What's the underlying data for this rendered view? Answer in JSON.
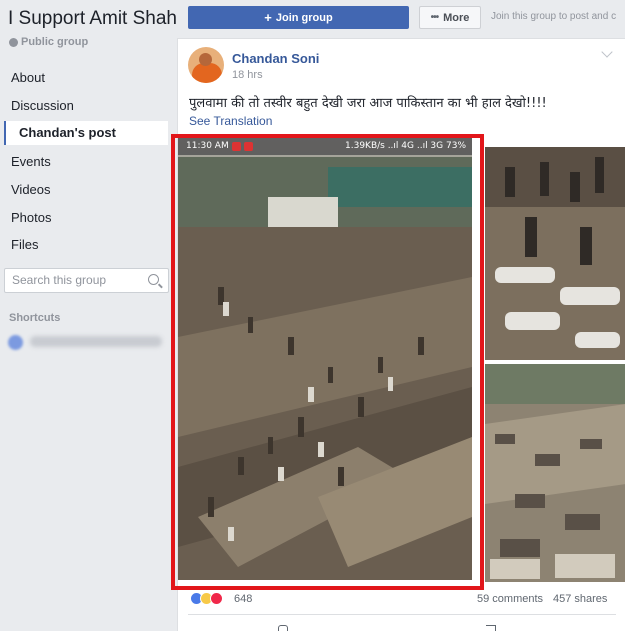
{
  "sidebar": {
    "group_title": "I Support Amit Shah",
    "privacy": "Public group",
    "nav": [
      "About",
      "Discussion",
      "Chandan's post",
      "Events",
      "Videos",
      "Photos",
      "Files"
    ],
    "active_item": "Chandan's post",
    "search_placeholder": "Search this group",
    "shortcuts_heading": "Shortcuts"
  },
  "header": {
    "join_label": "Join group",
    "more_label": "More",
    "join_hint": "Join this group to post and c"
  },
  "post": {
    "author": "Chandan Soni",
    "time": "18 hrs",
    "text": "पुलवामा की तो तस्वीर बहुत देखी जरा आज पाकिस्तान का भी हाल देखो!!!!",
    "see_translation": "See Translation",
    "status_bar": {
      "time": "11:30 AM",
      "right": "1.39KB/s ..ıl 4G ..ıl 3G 73%"
    },
    "reaction_count": "648",
    "comments": "59 comments",
    "shares": "457 shares"
  },
  "colors": {
    "accent": "#4267b2",
    "link": "#365899",
    "highlight": "#e2161a",
    "background": "#e9ebee"
  }
}
